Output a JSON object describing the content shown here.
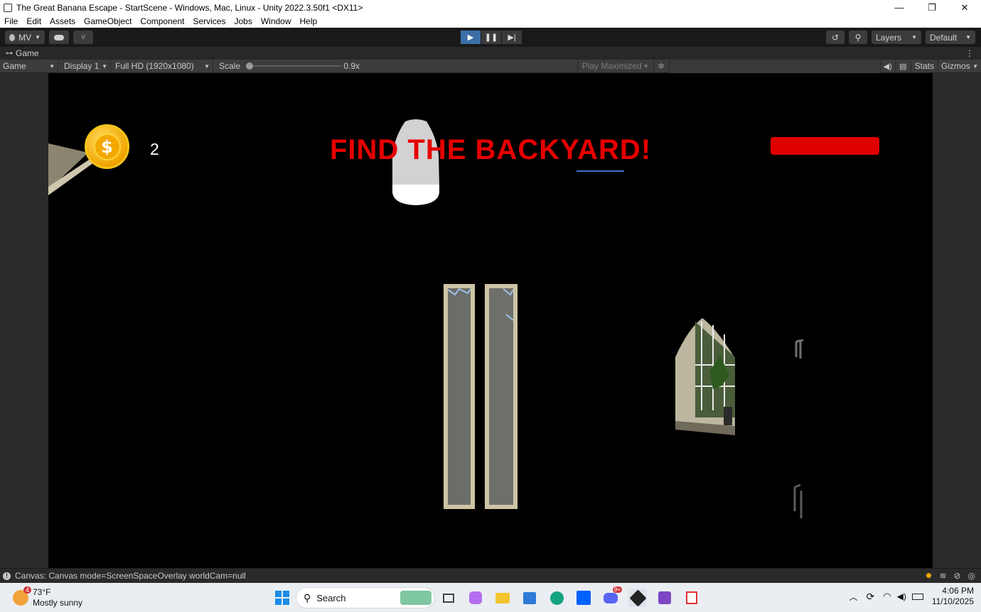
{
  "window": {
    "title": "The Great Banana Escape - StartScene - Windows, Mac, Linux - Unity 2022.3.50f1 <DX11>",
    "minimize": "—",
    "maximize": "❐",
    "close": "✕"
  },
  "menu": [
    "File",
    "Edit",
    "Assets",
    "GameObject",
    "Component",
    "Services",
    "Jobs",
    "Window",
    "Help"
  ],
  "toolbar": {
    "account": "MV",
    "layers": "Layers",
    "layout": "Default"
  },
  "tab": {
    "label": "Game"
  },
  "gamebar": {
    "view": "Game",
    "display": "Display 1",
    "resolution": "Full HD (1920x1080)",
    "scale_label": "Scale",
    "scale_value": "0.9x",
    "scale_level": 0.0,
    "play_mode": "Play Maximized",
    "stats": "Stats",
    "gizmos": "Gizmos"
  },
  "hud": {
    "coin_count": "2",
    "objective": "FIND THE BACKYARD!",
    "health_fraction": 1.0,
    "objective_color": "#e60000",
    "health_color": "#e00000"
  },
  "status": {
    "message": "Canvas: Canvas mode=ScreenSpaceOverlay worldCam=null"
  },
  "taskbar": {
    "weather_badge": "4",
    "temperature": "73°F",
    "condition": "Mostly sunny",
    "search": "Search",
    "discord_badge": "9+",
    "time": "4:06 PM",
    "date": "11/10/2025"
  }
}
